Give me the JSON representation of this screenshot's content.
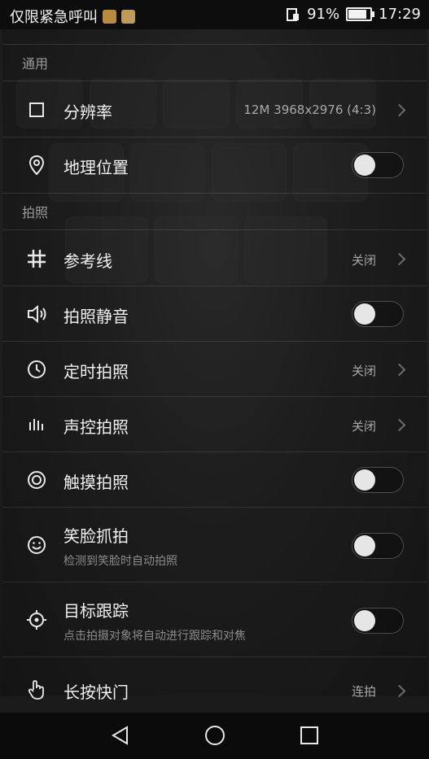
{
  "status_bar": {
    "carrier_text": "仅限紧急呼叫",
    "battery": "91%",
    "time": "17:29"
  },
  "sections": {
    "general": "通用",
    "photo": "拍照"
  },
  "settings": {
    "resolution": {
      "label": "分辨率",
      "value": "12M 3968x2976 (4:3)"
    },
    "location": {
      "label": "地理位置"
    },
    "grid": {
      "label": "参考线",
      "value": "关闭"
    },
    "mute": {
      "label": "拍照静音"
    },
    "timer": {
      "label": "定时拍照",
      "value": "关闭"
    },
    "voice": {
      "label": "声控拍照",
      "value": "关闭"
    },
    "touch": {
      "label": "触摸拍照"
    },
    "smile": {
      "label": "笑脸抓拍",
      "sub": "检测到笑脸时自动拍照"
    },
    "tracking": {
      "label": "目标跟踪",
      "sub": "点击拍摄对象将自动进行跟踪和对焦"
    },
    "longpress": {
      "label": "长按快门",
      "value": "连拍"
    }
  },
  "colors": {
    "panel": "#1b1b1b",
    "toggle_knob": "#e6e6e6",
    "muted_text": "#a8a8a8"
  }
}
